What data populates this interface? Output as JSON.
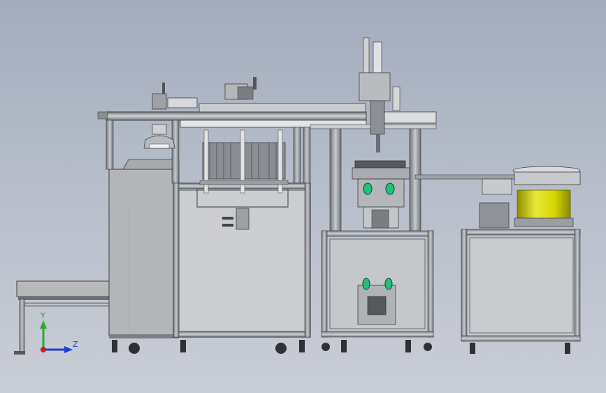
{
  "triad": {
    "y_label": "Y",
    "z_label": "Z",
    "y_color": "#2ea82e",
    "z_color": "#1a3fd8",
    "x_color": "#d81a1a"
  },
  "colors": {
    "frame_dark": "#3a3d42",
    "frame_light": "#9da1a6",
    "cabinet": "#b9bbbd",
    "hopper": "#d9d900",
    "roller": "#1ec27a"
  }
}
